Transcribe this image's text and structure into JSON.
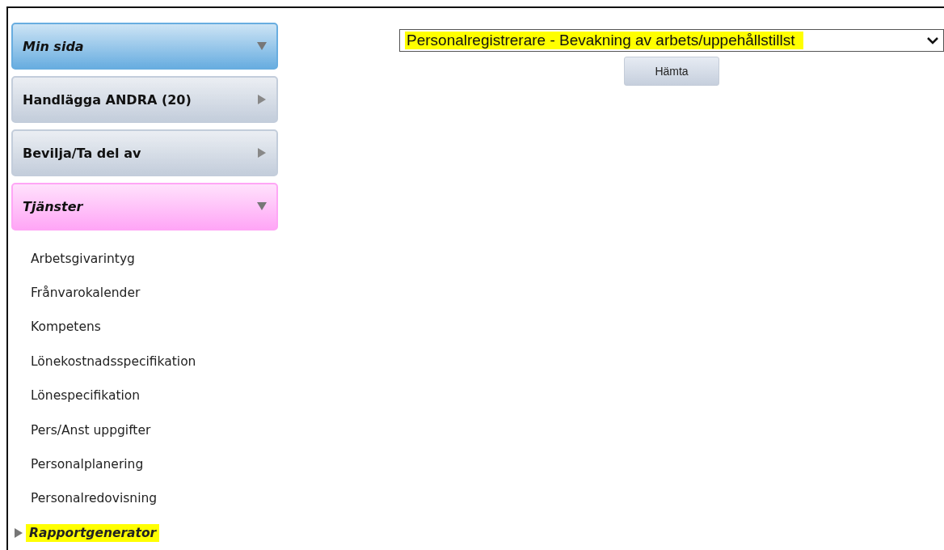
{
  "sidebar": {
    "sections": [
      {
        "label": "Min sida",
        "italic": true,
        "expanded": true,
        "color": "#68ade0"
      },
      {
        "label": "Handlägga ANDRA (20)",
        "italic": false,
        "expanded": false,
        "color": "#c3cddb"
      },
      {
        "label": "Bevilja/Ta del av",
        "italic": false,
        "expanded": false,
        "color": "#c3cddb"
      },
      {
        "label": "Tjänster",
        "italic": true,
        "expanded": true,
        "color": "#ffa6f6"
      }
    ],
    "items": [
      {
        "label": "Arbetsgivarintyg",
        "selected": false,
        "highlighted": false
      },
      {
        "label": "Frånvarokalender",
        "selected": false,
        "highlighted": false
      },
      {
        "label": "Kompetens",
        "selected": false,
        "highlighted": false
      },
      {
        "label": "Lönekostnadsspecifikation",
        "selected": false,
        "highlighted": false
      },
      {
        "label": "Lönespecifikation",
        "selected": false,
        "highlighted": false
      },
      {
        "label": "Pers/Anst uppgifter",
        "selected": false,
        "highlighted": false
      },
      {
        "label": "Personalplanering",
        "selected": false,
        "highlighted": false
      },
      {
        "label": "Personalredovisning",
        "selected": false,
        "highlighted": false
      },
      {
        "label": "Rapportgenerator",
        "selected": true,
        "highlighted": true
      }
    ]
  },
  "report_select": {
    "value": "Personalregistrerare - Bevakning av arbets/uppehållstillst",
    "highlighted": true
  },
  "fetch_button": "Hämta"
}
